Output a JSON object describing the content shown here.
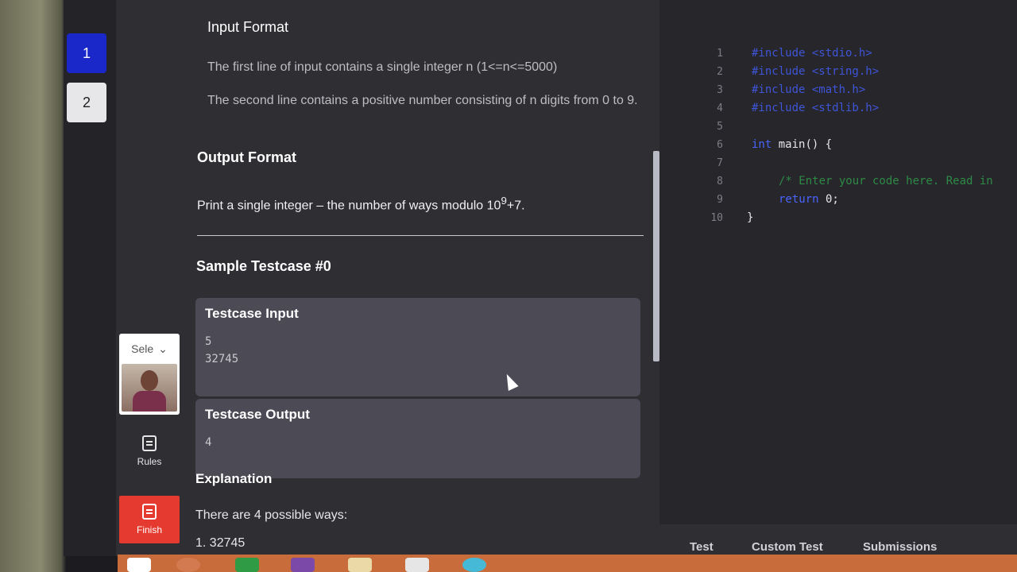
{
  "questions": [
    {
      "label": "1"
    },
    {
      "label": "2"
    }
  ],
  "camera": {
    "select_label": "Sele"
  },
  "sidebar": {
    "rules": "Rules",
    "finish": "Finish"
  },
  "problem": {
    "input_heading": "Input Format",
    "input_line1": "The first line of input contains a single integer n (1<=n<=5000)",
    "input_line2": "The second line contains a positive number consisting of n digits from 0 to 9.",
    "output_heading": "Output Format",
    "output_text_prefix": "Print a single integer – the number of ways modulo 10",
    "output_text_sup": "9",
    "output_text_suffix": "+7.",
    "sample_heading": "Sample Testcase #0",
    "testcase_input_label": "Testcase Input",
    "testcase_input_values": [
      "5",
      "32745"
    ],
    "testcase_output_label": "Testcase Output",
    "testcase_output_value": "4",
    "explanation_heading": "Explanation",
    "explanation_text": "There are 4 possible ways:",
    "explanation_item1": "1. 32745"
  },
  "editor": {
    "lines": [
      "1",
      "2",
      "3",
      "4",
      "5",
      "6",
      "7",
      "8",
      "9",
      "10"
    ],
    "includes": [
      "#include <stdio.h>",
      "#include <string.h>",
      "#include <math.h>",
      "#include <stdlib.h>"
    ],
    "main_sig_kw": "int",
    "main_sig_rest": " main() {",
    "comment": "/* Enter your code here. Read in",
    "return_kw": "return",
    "return_rest": " 0;",
    "close": "}"
  },
  "bottom_tabs": {
    "test": "Test",
    "custom_test": "Custom Test",
    "submissions": "Submissions"
  },
  "colors": {
    "accent": "#1a28c9",
    "finish": "#e53a2f",
    "keyword": "#4a64ff",
    "comment": "#2e8a46"
  }
}
